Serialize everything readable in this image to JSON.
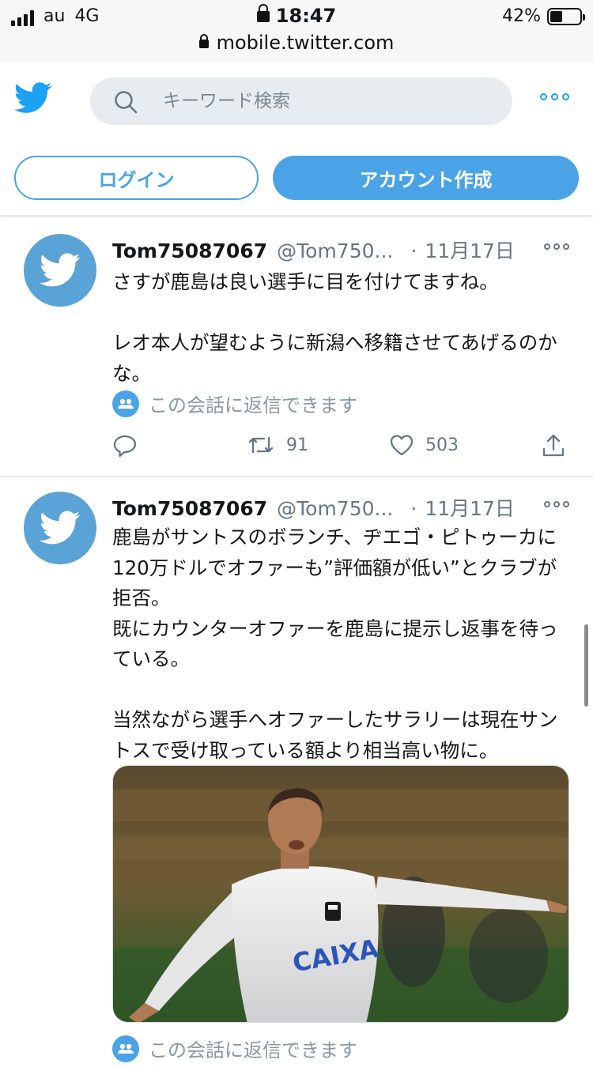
{
  "status_bar": {
    "carrier": "au",
    "network": "4G",
    "time": "18:47",
    "battery": "42%",
    "battery_level": 0.42,
    "url": "mobile.twitter.com"
  },
  "header": {
    "search_placeholder": "キーワード検索",
    "login_label": "ログイン",
    "signup_label": "アカウント作成"
  },
  "tweets": [
    {
      "name": "Tom75087067",
      "handle": "@Tom750...",
      "dot": "·",
      "date": "11月17日",
      "text": "さすが鹿島は良い選手に目を付けてますね。\n\nレオ本人が望むように新潟へ移籍させてあげるのかな。",
      "reply_note": "この会話に返信できます",
      "retweets": "91",
      "likes": "503"
    },
    {
      "name": "Tom75087067",
      "handle": "@Tom750...",
      "dot": "·",
      "date": "11月17日",
      "text": "鹿島がサントスのボランチ、ヂエゴ・ピトゥーカに120万ドルでオファーも”評価額が低い”とクラブが拒否。\n既にカウンターオファーを鹿島に提示し返事を待っている。\n\n当然ながら選手へオファーしたサラリーは現在サントスで受け取っている額より相当高い物に。",
      "reply_note": "この会話に返信できます",
      "jersey_text": "CAIXA"
    }
  ],
  "colors": {
    "brand": "#1da1f2",
    "button": "#4aa3e6",
    "avatar": "#5aa3d6",
    "muted": "#657786"
  }
}
